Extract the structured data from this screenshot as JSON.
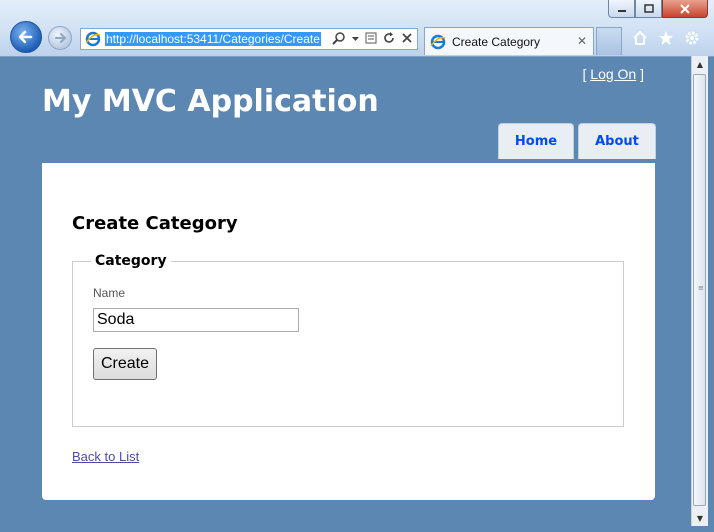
{
  "browser": {
    "address_url": "http://localhost:53411/Categories/Create",
    "tab_title": "Create Category",
    "tab_close": "✕"
  },
  "site": {
    "logon_prefix": "[ ",
    "logon_label": "Log On",
    "logon_suffix": " ]",
    "title": "My MVC Application",
    "menu": [
      "Home",
      "About"
    ]
  },
  "content": {
    "heading": "Create Category",
    "legend": "Category",
    "name_label": "Name",
    "name_value": "Soda",
    "create_label": "Create",
    "back_link": "Back to List"
  },
  "colors": {
    "page_bg": "#5c87b2",
    "menu_text": "#034af3",
    "link": "#4b4ba8"
  },
  "icons": [
    "back-icon",
    "forward-icon",
    "ie-page-icon",
    "search-icon",
    "compat-view-icon",
    "refresh-icon",
    "stop-icon",
    "home-icon",
    "favorites-star-icon",
    "tools-gear-icon",
    "minimize-icon",
    "maximize-icon",
    "close-icon"
  ]
}
